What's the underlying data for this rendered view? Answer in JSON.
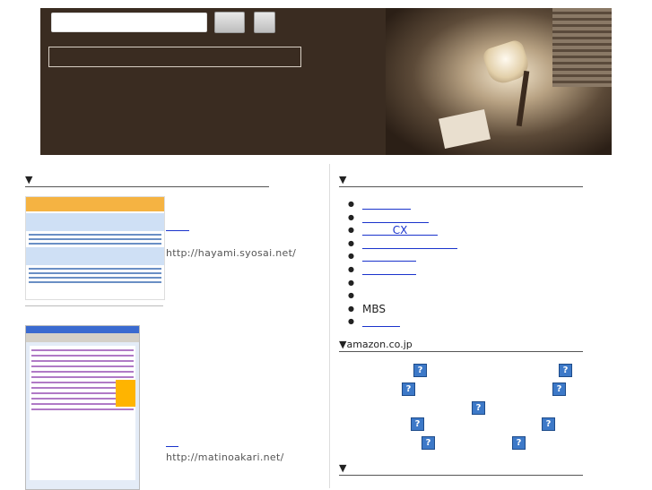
{
  "left": {
    "heading": "▼",
    "sites": [
      {
        "url": "http://hayami.syosai.net/"
      },
      {
        "url": "http://matinoakari.net/"
      }
    ]
  },
  "right": {
    "heading1": "▼",
    "list": [
      "",
      "",
      "CX",
      "",
      "",
      "",
      "",
      "",
      "MBS",
      ""
    ],
    "heading2": "▼amazon.co.jp",
    "heading3": "▼",
    "question_glyph": "?"
  },
  "icons": {
    "bullet": "bullet-icon",
    "missing_image": "question-image-icon"
  }
}
